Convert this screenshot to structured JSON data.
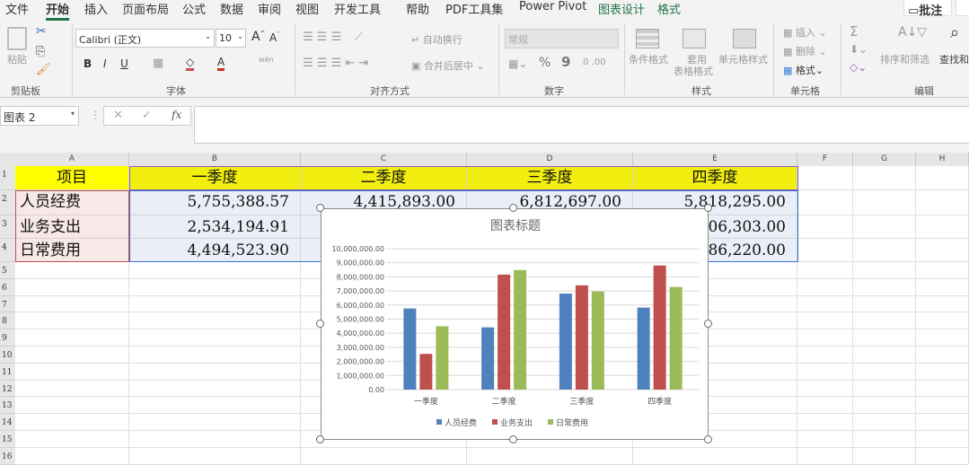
{
  "ribbon": {
    "tabs": [
      "文件",
      "开始",
      "插入",
      "页面布局",
      "公式",
      "数据",
      "审阅",
      "视图",
      "开发工具",
      "帮助",
      "PDF工具集",
      "Power Pivot",
      "图表设计",
      "格式"
    ],
    "comment_button": "批注",
    "clipboard": {
      "paste": "粘贴",
      "label": "剪贴板"
    },
    "font": {
      "name": "Calibri (正文)",
      "size": "10",
      "bold": "B",
      "italic": "I",
      "underline": "U",
      "label": "字体",
      "wen": "wén"
    },
    "alignment": {
      "wrap": "自动换行",
      "merge": "合并后居中",
      "label": "对齐方式"
    },
    "number": {
      "format": "常规",
      "percent": "%",
      "comma": "9",
      "label": "数字"
    },
    "styles": {
      "conditional": "条件格式",
      "table1": "套用",
      "table2": "表格格式",
      "cell": "单元格样式",
      "label": "样式"
    },
    "cells": {
      "insert": "插入",
      "delete": "删除",
      "format": "格式",
      "label": "单元格"
    },
    "editing": {
      "sort": "排序和筛选",
      "find": "查找和",
      "label": "编辑",
      "sum": "Σ"
    }
  },
  "formula_bar": {
    "name_box": "图表 2",
    "fx": "fx",
    "cancel": "✕",
    "enter": "✓",
    "value": ""
  },
  "columns": [
    "A",
    "B",
    "C",
    "D",
    "E",
    "F",
    "G",
    "H"
  ],
  "rows": [
    "1",
    "2",
    "3",
    "4",
    "5",
    "6",
    "7",
    "8",
    "9",
    "10",
    "11",
    "12",
    "13",
    "14",
    "15",
    "16"
  ],
  "sheet": {
    "header": [
      "项目",
      "一季度",
      "二季度",
      "三季度",
      "四季度"
    ],
    "data": [
      [
        "人员经费",
        "5,755,388.57",
        "4,415,893.00",
        "6,812,697.00",
        "5,818,295.00"
      ],
      [
        "业务支出",
        "2,534,194.91",
        "",
        "",
        "8,806,303.00"
      ],
      [
        "日常费用",
        "4,494,523.90",
        "",
        "",
        "7,286,220.00"
      ]
    ]
  },
  "chart_data": {
    "type": "bar",
    "title": "图表标题",
    "categories": [
      "一季度",
      "二季度",
      "三季度",
      "四季度"
    ],
    "series": [
      {
        "name": "人员经费",
        "color": "#4f81bd",
        "values": [
          5755388.57,
          4415893.0,
          6812697.0,
          5818295.0
        ]
      },
      {
        "name": "业务支出",
        "color": "#c0504d",
        "values": [
          2534194.91,
          8160000,
          7400000,
          8806303.0
        ]
      },
      {
        "name": "日常费用",
        "color": "#9bbb59",
        "values": [
          4494523.9,
          8480000,
          6960000,
          7286220.0
        ]
      }
    ],
    "ylim": [
      0,
      10000000
    ],
    "yticks": [
      "0.00",
      "1,000,000.00",
      "2,000,000.00",
      "3,000,000.00",
      "4,000,000.00",
      "5,000,000.00",
      "6,000,000.00",
      "7,000,000.00",
      "8,000,000.00",
      "9,000,000.00",
      "10,000,000.00"
    ],
    "legend": "bottom",
    "grid": true
  }
}
